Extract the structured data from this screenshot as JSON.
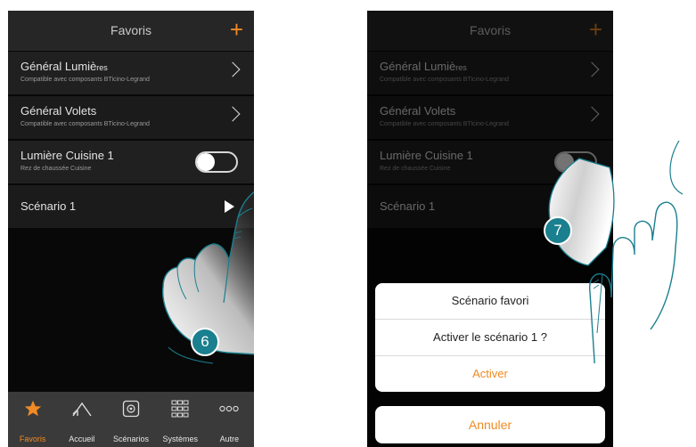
{
  "header": {
    "title": "Favoris",
    "add_icon": "+"
  },
  "rows": [
    {
      "name": "Général Lumiè",
      "name_small": "res",
      "sub": "Compatible avec composants BTicino-Legrand"
    },
    {
      "name": "Général Volets",
      "sub": "Compatible avec composants BTicino-Legrand"
    },
    {
      "name": "Lumière Cuisine 1",
      "sub": "Rez de chaussée Cuisine"
    },
    {
      "name": "Scénario 1"
    }
  ],
  "tabs": [
    {
      "label": "Favoris",
      "icon": "star-icon"
    },
    {
      "label": "Accueil",
      "icon": "house-icon"
    },
    {
      "label": "Scénarios",
      "icon": "scenario-icon"
    },
    {
      "label": "Systèmes",
      "icon": "grid-icon"
    },
    {
      "label": "Autre",
      "icon": "dots-icon"
    }
  ],
  "steps": {
    "left": "6",
    "right": "7"
  },
  "dialog": {
    "title": "Scénario favori",
    "message": "Activer le scénario 1 ?",
    "confirm": "Activer",
    "cancel": "Annuler"
  },
  "colors": {
    "accent": "#f08a24",
    "badge": "#1a7f8e"
  }
}
